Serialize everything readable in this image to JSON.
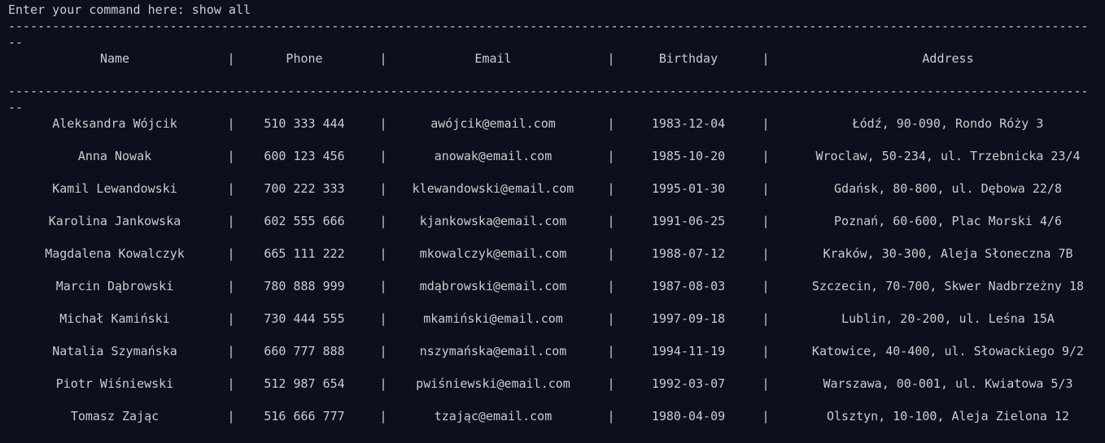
{
  "terminal": {
    "prompt_label": "Enter your command here: ",
    "command": "show all",
    "separator_char": "-",
    "column_separator": "|"
  },
  "table": {
    "headers": [
      "Name",
      "Phone",
      "Email",
      "Birthday",
      "Address"
    ],
    "rows": [
      [
        "Aleksandra Wójcik",
        "510 333 444",
        "awójcik@email.com",
        "1983-12-04",
        "Łódź, 90-090, Rondo Róży 3"
      ],
      [
        "Anna Nowak",
        "600 123 456",
        "anowak@email.com",
        "1985-10-20",
        "Wroclaw, 50-234, ul. Trzebnicka 23/4"
      ],
      [
        "Kamil Lewandowski",
        "700 222 333",
        "klewandowski@email.com",
        "1995-01-30",
        "Gdańsk, 80-800, ul. Dębowa 22/8"
      ],
      [
        "Karolina Jankowska",
        "602 555 666",
        "kjankowska@email.com",
        "1991-06-25",
        "Poznań, 60-600, Plac Morski 4/6"
      ],
      [
        "Magdalena Kowalczyk",
        "665 111 222",
        "mkowalczyk@email.com",
        "1988-07-12",
        "Kraków, 30-300, Aleja Słoneczna 7B"
      ],
      [
        "Marcin Dąbrowski",
        "780 888 999",
        "mdąbrowski@email.com",
        "1987-08-03",
        "Szczecin, 70-700, Skwer Nadbrzeżny 18"
      ],
      [
        "Michał Kamiński",
        "730 444 555",
        "mkamiński@email.com",
        "1997-09-18",
        "Lublin, 20-200, ul. Leśna 15A"
      ],
      [
        "Natalia Szymańska",
        "660 777 888",
        "nszymańska@email.com",
        "1994-11-19",
        "Katowice, 40-400, ul. Słowackiego 9/2"
      ],
      [
        "Piotr Wiśniewski",
        "512 987 654",
        "pwiśniewski@email.com",
        "1992-03-07",
        "Warszawa, 00-001, ul. Kwiatowa 5/3"
      ],
      [
        "Tomasz Zając",
        "516 666 777",
        "tzając@email.com",
        "1980-04-09",
        "Olsztyn, 10-100, Aleja Zielona 12"
      ]
    ]
  },
  "colors": {
    "background": "#0c0f1e",
    "text": "#cccccc"
  }
}
